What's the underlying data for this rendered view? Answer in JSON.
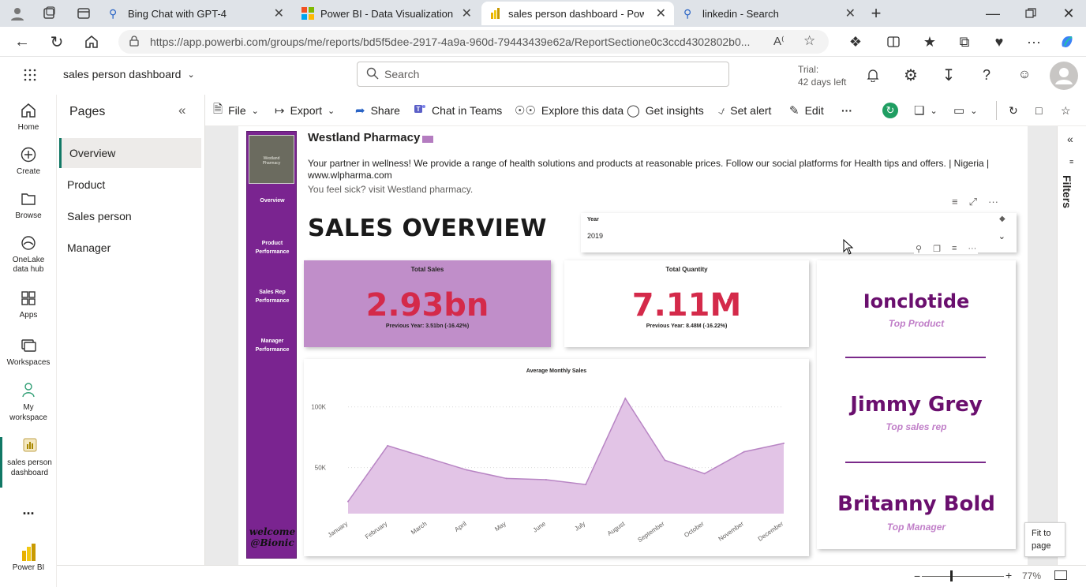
{
  "browser": {
    "tabs": [
      {
        "label": "Bing Chat with GPT-4"
      },
      {
        "label": "Power BI - Data Visualization | M"
      },
      {
        "label": "sales person dashboard - Power"
      },
      {
        "label": "linkedin - Search"
      }
    ],
    "url": "https://app.powerbi.com/groups/me/reports/bd5f5dee-2917-4a9a-960d-79443439e62a/ReportSectione0c3ccd4302802b0..."
  },
  "header": {
    "report_name": "sales person dashboard",
    "search_placeholder": "Search",
    "trial_line1": "Trial:",
    "trial_line2": "42 days left"
  },
  "rail": {
    "items": [
      {
        "label": "Home",
        "icon": "home-icon"
      },
      {
        "label": "Create",
        "icon": "plus-circle-icon"
      },
      {
        "label": "Browse",
        "icon": "folder-icon"
      },
      {
        "label": "OneLake data hub",
        "icon": "onelake-icon"
      },
      {
        "label": "Apps",
        "icon": "apps-icon"
      },
      {
        "label": "Workspaces",
        "icon": "workspaces-icon"
      },
      {
        "label": "My workspace",
        "icon": "person-icon"
      },
      {
        "label": "sales person dashboard",
        "icon": "report-icon"
      }
    ],
    "more": "...",
    "brand": "Power BI"
  },
  "pages": {
    "title": "Pages",
    "items": [
      "Overview",
      "Product",
      "Sales person",
      "Manager"
    ]
  },
  "toolbar": {
    "file": "File",
    "export": "Export",
    "share": "Share",
    "chat": "Chat in Teams",
    "explore": "Explore this data",
    "insights": "Get insights",
    "alert": "Set alert",
    "edit": "Edit",
    "more": "···"
  },
  "report": {
    "company": "Westland Pharmacy",
    "tagline": "Your partner in wellness! We provide a range of health solutions and products at reasonable prices. Follow our social platforms for Health tips and offers. | Nigeria |",
    "website": "www.wlpharma.com",
    "cta": "You feel sick? visit Westland pharmacy.",
    "heading": "SALES OVERVIEW",
    "nav": [
      "Overview",
      "Product Performance",
      "Sales Rep Performance",
      "Manager Performance"
    ],
    "welcome_line1": "welcome",
    "welcome_line2": "@Bionic",
    "logo_text": "Westland Pharmacy",
    "slicer": {
      "label": "Year",
      "value": "2019"
    },
    "total_sales": {
      "title": "Total Sales",
      "value": "2.93bn",
      "prev": "Previous Year: 3.51bn (-16.42%)"
    },
    "total_qty": {
      "title": "Total Quantity",
      "value": "7.11M",
      "prev": "Previous Year: 8.48M (-16.22%)"
    },
    "top_product": {
      "name": "Ionclotide",
      "label": "Top Product"
    },
    "top_rep": {
      "name": "Jimmy Grey",
      "label": "Top sales rep"
    },
    "top_manager": {
      "name": "Britanny Bold",
      "label": "Top Manager"
    }
  },
  "filters_label": "Filters",
  "status": {
    "zoom": "77%",
    "fit_line1": "Fit to",
    "fit_line2": "page"
  },
  "colors": {
    "accent": "#7a2490",
    "kpi_red": "#d42a4a",
    "name_purple": "#6a0f6e",
    "area_fill": "#e2c4e6",
    "area_line": "#b885c4"
  },
  "chart_data": {
    "type": "area",
    "title": "Average Monthly Sales",
    "categories": [
      "January",
      "February",
      "March",
      "April",
      "May",
      "June",
      "July",
      "August",
      "September",
      "October",
      "November",
      "December"
    ],
    "values": [
      22000,
      68000,
      58000,
      48000,
      41000,
      40000,
      36000,
      107000,
      56000,
      45000,
      63000,
      70000
    ],
    "yticks": [
      "50K",
      "100K"
    ],
    "ytick_values": [
      50000,
      100000
    ],
    "ylim": [
      12000,
      120000
    ]
  }
}
